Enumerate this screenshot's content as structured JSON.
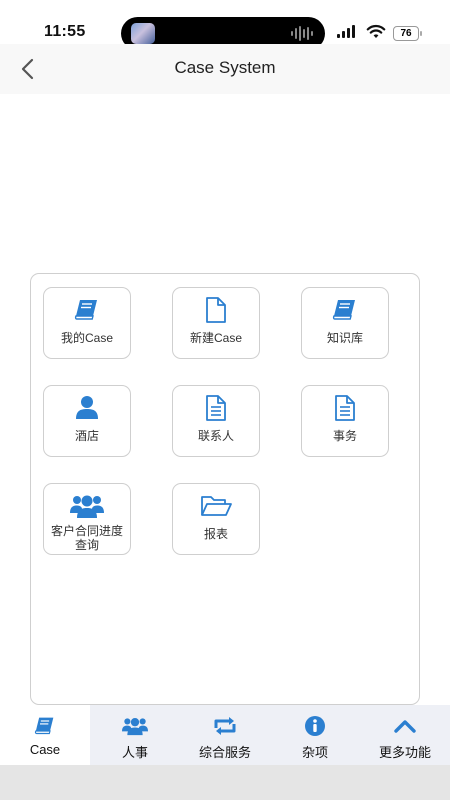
{
  "status_bar": {
    "time": "11:55",
    "battery": "76"
  },
  "nav": {
    "title": "Case System"
  },
  "colors": {
    "accent": "#2b7fd0"
  },
  "tiles": [
    {
      "label": "我的Case",
      "icon": "book-icon"
    },
    {
      "label": "新建Case",
      "icon": "file-icon"
    },
    {
      "label": "知识库",
      "icon": "book-icon"
    },
    {
      "label": "酒店",
      "icon": "user-icon"
    },
    {
      "label": "联系人",
      "icon": "document-icon"
    },
    {
      "label": "事务",
      "icon": "document-icon"
    },
    {
      "label": "客户合同进度查询",
      "icon": "users-icon"
    },
    {
      "label": "报表",
      "icon": "folder-open-icon"
    }
  ],
  "tabs": [
    {
      "label": "Case",
      "icon": "book-icon",
      "active": true
    },
    {
      "label": "人事",
      "icon": "users-icon"
    },
    {
      "label": "综合服务",
      "icon": "retweet-icon"
    },
    {
      "label": "杂项",
      "icon": "info-icon"
    },
    {
      "label": "更多功能",
      "icon": "chevron-up-icon"
    }
  ]
}
